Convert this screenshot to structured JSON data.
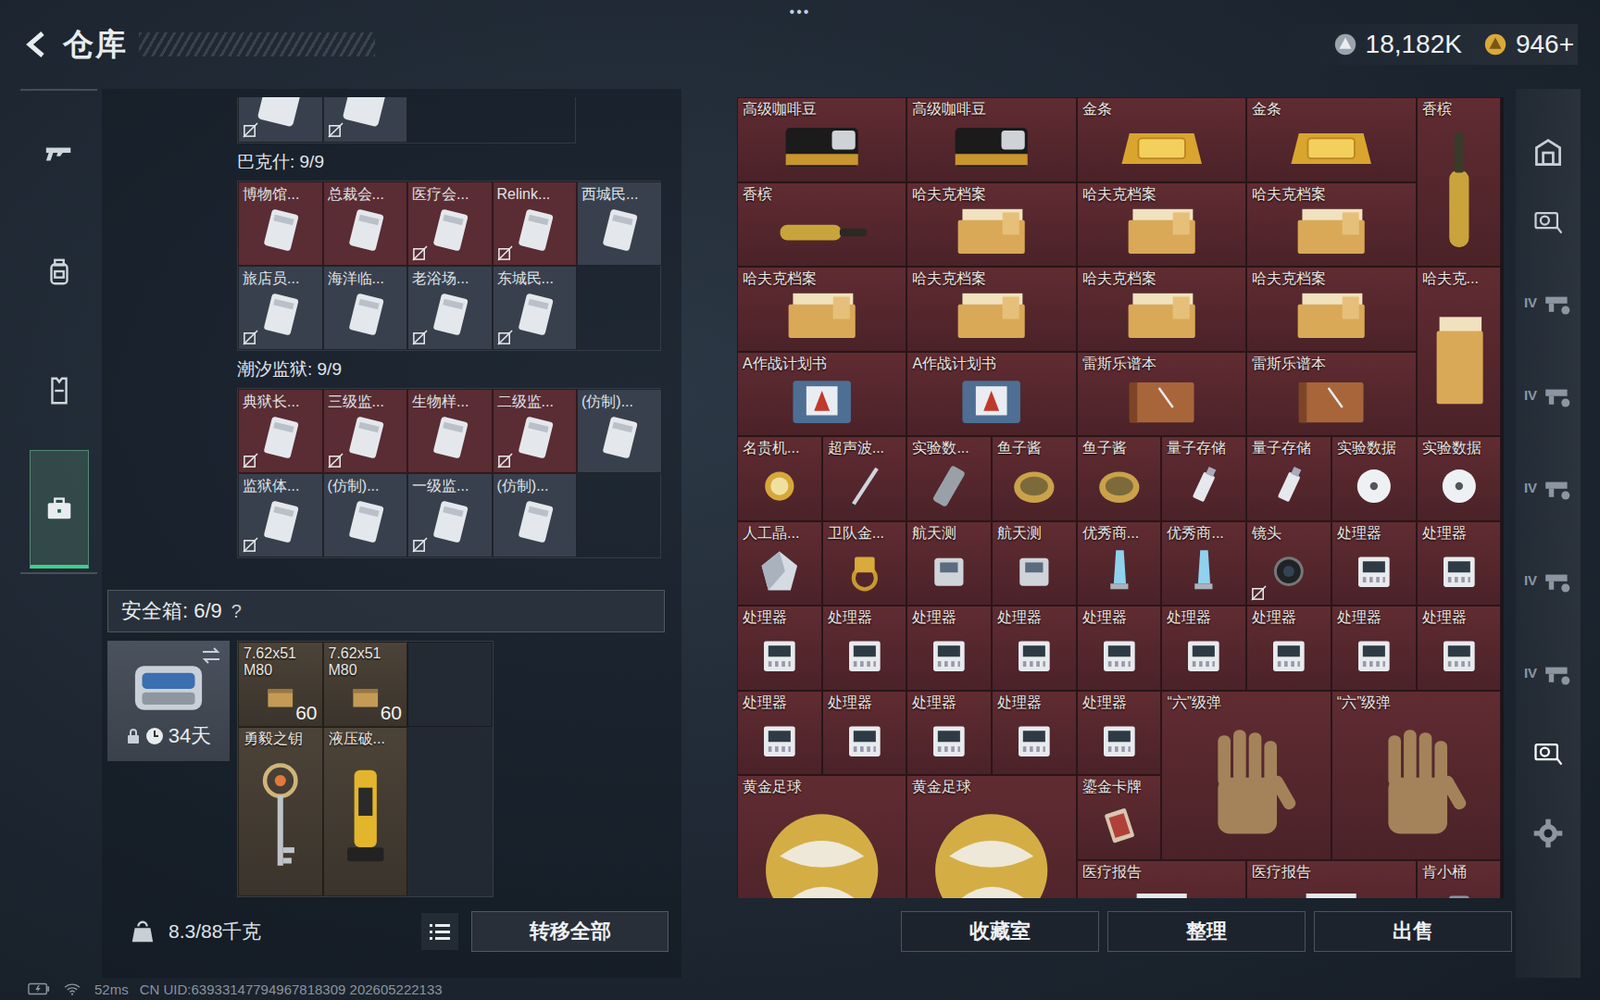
{
  "header": {
    "title": "仓库",
    "menu": "•••",
    "currencies": [
      {
        "kind": "silver",
        "amount": "18,182K"
      },
      {
        "kind": "gold",
        "amount": "946+"
      }
    ]
  },
  "left_nav": [
    {
      "kind": "gun",
      "selected": false
    },
    {
      "kind": "backpack",
      "selected": false
    },
    {
      "kind": "vest",
      "selected": false
    },
    {
      "kind": "toolbox",
      "selected": true
    }
  ],
  "partial_keys": [
    {
      "bound": true,
      "color": "#39404d"
    },
    {
      "bound": true,
      "color": "#39404d"
    }
  ],
  "key_groups": [
    {
      "title": "巴克什: 9/9",
      "keys": [
        {
          "name": "博物馆...",
          "bound": false,
          "color": "#5a2c33"
        },
        {
          "name": "总裁会...",
          "bound": false,
          "color": "#5a2c33"
        },
        {
          "name": "医疗会...",
          "bound": true,
          "color": "#5a2c33"
        },
        {
          "name": "Relink...",
          "bound": true,
          "color": "#5a2c33"
        },
        {
          "name": "西城民...",
          "bound": false,
          "color": "#39404d"
        },
        {
          "name": "旅店员...",
          "bound": true,
          "color": "#39404d"
        },
        {
          "name": "海洋临...",
          "bound": false,
          "color": "#39404d"
        },
        {
          "name": "老浴场...",
          "bound": true,
          "color": "#39404d"
        },
        {
          "name": "东城民...",
          "bound": true,
          "color": "#39404d"
        }
      ]
    },
    {
      "title": "潮汐监狱: 9/9",
      "keys": [
        {
          "name": "典狱长...",
          "bound": true,
          "color": "#5a2c33"
        },
        {
          "name": "三级监...",
          "bound": true,
          "color": "#5a2c33"
        },
        {
          "name": "生物样...",
          "bound": false,
          "color": "#5a2c33"
        },
        {
          "name": "二级监...",
          "bound": true,
          "color": "#5a2c33"
        },
        {
          "name": "(仿制)...",
          "bound": false,
          "color": "#39404d"
        },
        {
          "name": "监狱体...",
          "bound": true,
          "color": "#39404d"
        },
        {
          "name": "(仿制)...",
          "bound": false,
          "color": "#39404d"
        },
        {
          "name": "一级监...",
          "bound": true,
          "color": "#39404d"
        },
        {
          "name": "(仿制)...",
          "bound": false,
          "color": "#39404d"
        }
      ]
    }
  ],
  "safe": {
    "title": "安全箱: 6/9",
    "help": "?",
    "days": "34天",
    "locked": true,
    "items": [
      {
        "kind": "ammo",
        "name": "7.62x51 M80",
        "count": "60",
        "w": 1,
        "h": 1
      },
      {
        "kind": "ammo",
        "name": "7.62x51 M80",
        "count": "60",
        "w": 1,
        "h": 1
      },
      {
        "kind": "empty",
        "w": 1,
        "h": 1
      },
      {
        "kind": "key",
        "name": "勇毅之钥",
        "w": 1,
        "h": 2
      },
      {
        "kind": "hydraulic",
        "name": "液压破...",
        "w": 1,
        "h": 2
      }
    ]
  },
  "bottom_bar": {
    "weight": "8.3/88千克",
    "transfer": "转移全部"
  },
  "stash": [
    {
      "name": "高级咖啡豆",
      "kind": "coffee",
      "w": 2,
      "h": 1,
      "bound": false
    },
    {
      "name": "高级咖啡豆",
      "kind": "coffee",
      "w": 2,
      "h": 1,
      "bound": false
    },
    {
      "name": "金条",
      "kind": "gold",
      "w": 2,
      "h": 1,
      "bound": false
    },
    {
      "name": "金条",
      "kind": "gold",
      "w": 2,
      "h": 1,
      "bound": false
    },
    {
      "name": "香槟",
      "kind": "bottle-v",
      "w": 1,
      "h": 2,
      "bound": false
    },
    {
      "name": "香槟",
      "kind": "bottle-h",
      "w": 2,
      "h": 1,
      "bound": false
    },
    {
      "name": "哈夫克档案",
      "kind": "folder",
      "w": 2,
      "h": 1,
      "bound": false
    },
    {
      "name": "哈夫克档案",
      "kind": "folder",
      "w": 2,
      "h": 1,
      "bound": false
    },
    {
      "name": "哈夫克档案",
      "kind": "folder",
      "w": 2,
      "h": 1,
      "bound": false
    },
    {
      "name": "哈夫克档案",
      "kind": "folder",
      "w": 2,
      "h": 1,
      "bound": false
    },
    {
      "name": "哈夫克档案",
      "kind": "folder",
      "w": 2,
      "h": 1,
      "bound": false
    },
    {
      "name": "哈夫克档案",
      "kind": "folder",
      "w": 2,
      "h": 1,
      "bound": false
    },
    {
      "name": "哈夫克档案",
      "kind": "folder",
      "w": 2,
      "h": 1,
      "bound": false
    },
    {
      "name": "哈夫克...",
      "kind": "folder-v",
      "w": 1,
      "h": 2,
      "bound": false
    },
    {
      "name": "A作战计划书",
      "kind": "plan",
      "w": 2,
      "h": 1,
      "bound": false
    },
    {
      "name": "A作战计划书",
      "kind": "plan",
      "w": 2,
      "h": 1,
      "bound": false
    },
    {
      "name": "雷斯乐谱本",
      "kind": "book",
      "w": 2,
      "h": 1,
      "bound": false
    },
    {
      "name": "雷斯乐谱本",
      "kind": "book",
      "w": 2,
      "h": 1,
      "bound": false
    },
    {
      "name": "名贵机...",
      "kind": "watch",
      "w": 1,
      "h": 1,
      "bound": false
    },
    {
      "name": "超声波...",
      "kind": "pen",
      "w": 1,
      "h": 1,
      "bound": false
    },
    {
      "name": "实验数...",
      "kind": "flashlight",
      "w": 1,
      "h": 1,
      "bound": false
    },
    {
      "name": "鱼子酱",
      "kind": "caviar",
      "w": 1,
      "h": 1,
      "bound": false
    },
    {
      "name": "鱼子酱",
      "kind": "caviar",
      "w": 1,
      "h": 1,
      "bound": false
    },
    {
      "name": "量子存储",
      "kind": "usb",
      "w": 1,
      "h": 1,
      "bound": false
    },
    {
      "name": "量子存储",
      "kind": "usb",
      "w": 1,
      "h": 1,
      "bound": false
    },
    {
      "name": "实验数据",
      "kind": "disc",
      "w": 1,
      "h": 1,
      "bound": false
    },
    {
      "name": "实验数据",
      "kind": "disc",
      "w": 1,
      "h": 1,
      "bound": false
    },
    {
      "name": "人工晶...",
      "kind": "crystal",
      "w": 1,
      "h": 1,
      "bound": false
    },
    {
      "name": "卫队金...",
      "kind": "ring",
      "w": 1,
      "h": 1,
      "bound": false
    },
    {
      "name": "航天测",
      "kind": "device",
      "w": 1,
      "h": 1,
      "bound": false
    },
    {
      "name": "航天测",
      "kind": "device",
      "w": 1,
      "h": 1,
      "bound": false
    },
    {
      "name": "优秀商...",
      "kind": "trophy",
      "w": 1,
      "h": 1,
      "bound": false
    },
    {
      "name": "优秀商...",
      "kind": "trophy",
      "w": 1,
      "h": 1,
      "bound": false
    },
    {
      "name": "镜头",
      "kind": "lens",
      "w": 1,
      "h": 1,
      "bound": true
    },
    {
      "name": "处理器",
      "kind": "cpu",
      "w": 1,
      "h": 1,
      "bound": false
    },
    {
      "name": "处理器",
      "kind": "cpu",
      "w": 1,
      "h": 1,
      "bound": false
    },
    {
      "name": "处理器",
      "kind": "cpu",
      "w": 1,
      "h": 1,
      "bound": false
    },
    {
      "name": "处理器",
      "kind": "cpu",
      "w": 1,
      "h": 1,
      "bound": false
    },
    {
      "name": "处理器",
      "kind": "cpu",
      "w": 1,
      "h": 1,
      "bound": false
    },
    {
      "name": "处理器",
      "kind": "cpu",
      "w": 1,
      "h": 1,
      "bound": false
    },
    {
      "name": "处理器",
      "kind": "cpu",
      "w": 1,
      "h": 1,
      "bound": false
    },
    {
      "name": "处理器",
      "kind": "cpu",
      "w": 1,
      "h": 1,
      "bound": false
    },
    {
      "name": "处理器",
      "kind": "cpu",
      "w": 1,
      "h": 1,
      "bound": false
    },
    {
      "name": "处理器",
      "kind": "cpu",
      "w": 1,
      "h": 1,
      "bound": false
    },
    {
      "name": "处理器",
      "kind": "cpu",
      "w": 1,
      "h": 1,
      "bound": false
    },
    {
      "name": "处理器",
      "kind": "cpu",
      "w": 1,
      "h": 1,
      "bound": false
    },
    {
      "name": "处理器",
      "kind": "cpu",
      "w": 1,
      "h": 1,
      "bound": false
    },
    {
      "name": "处理器",
      "kind": "cpu",
      "w": 1,
      "h": 1,
      "bound": false
    },
    {
      "name": "处理器",
      "kind": "cpu",
      "w": 1,
      "h": 1,
      "bound": false
    },
    {
      "name": "处理器",
      "kind": "cpu",
      "w": 1,
      "h": 1,
      "bound": false
    },
    {
      "name": "“六”级弹",
      "kind": "glove",
      "w": 2,
      "h": 2,
      "bound": false
    },
    {
      "name": "“六”级弹",
      "kind": "glove",
      "w": 2,
      "h": 2,
      "bound": false
    },
    {
      "name": "黄金足球",
      "kind": "ball",
      "w": 2,
      "h": 2,
      "bound": false
    },
    {
      "name": "黄金足球",
      "kind": "ball",
      "w": 2,
      "h": 2,
      "bound": false
    },
    {
      "name": "鎏金卡牌",
      "kind": "card",
      "w": 1,
      "h": 1,
      "bound": false
    },
    {
      "name": "医疗报告",
      "kind": "medical",
      "w": 2,
      "h": 1,
      "bound": false
    },
    {
      "name": "医疗报告",
      "kind": "medical",
      "w": 2,
      "h": 1,
      "bound": false
    },
    {
      "name": "肯小桶",
      "kind": "bucket",
      "w": 1,
      "h": 1,
      "bound": false
    }
  ],
  "stash_buttons": [
    "收藏室",
    "整理",
    "出售"
  ],
  "right_nav": [
    {
      "kind": "safehouse",
      "selected": false
    },
    {
      "kind": "card-reader",
      "selected": false
    },
    {
      "kind": "iv",
      "label": "IV",
      "selected": false
    },
    {
      "kind": "iv",
      "label": "IV",
      "selected": false
    },
    {
      "kind": "iv",
      "label": "IV",
      "selected": false
    },
    {
      "kind": "iv",
      "label": "IV",
      "selected": false
    },
    {
      "kind": "iv",
      "label": "IV",
      "selected": false
    },
    {
      "kind": "card-reader",
      "selected": true
    },
    {
      "kind": "gear",
      "selected": false
    }
  ],
  "status_bar": {
    "ping": "52ms",
    "uid": "CN UID:63933147794967818309 202605222133"
  }
}
